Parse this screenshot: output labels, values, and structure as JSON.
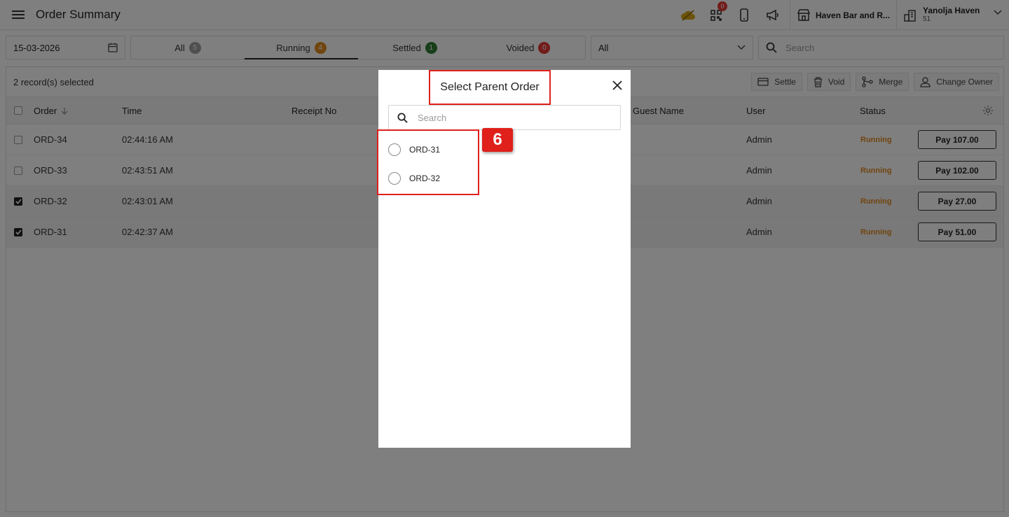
{
  "header": {
    "title": "Order Summary",
    "menu_icon": "hamburger-icon",
    "notification_count": "0",
    "venue_name": "Haven Bar and R...",
    "account_name": "Yanolja Haven",
    "account_sub": "51"
  },
  "filters": {
    "date": "15-03-2026",
    "tabs": [
      {
        "label": "All",
        "count": "5",
        "color": "#9e9e9e"
      },
      {
        "label": "Running",
        "count": "4",
        "color": "#e08a1e"
      },
      {
        "label": "Settled",
        "count": "1",
        "color": "#2e7d32"
      },
      {
        "label": "Voided",
        "count": "0",
        "color": "#e53935"
      }
    ],
    "active_tab": "Running",
    "status_value": "All",
    "search_placeholder": "Search"
  },
  "toolbar": {
    "selected_text": "2 record(s) selected",
    "actions": [
      "Settle",
      "Void",
      "Merge",
      "Change Owner"
    ]
  },
  "table": {
    "columns": [
      "Order",
      "Time",
      "Receipt No",
      "Guest Name",
      "User",
      "Status"
    ],
    "rows": [
      {
        "order": "ORD-34",
        "time": "02:44:16 AM",
        "user": "Admin",
        "status": "Running",
        "pay": "Pay 107.00",
        "checked": false
      },
      {
        "order": "ORD-33",
        "time": "02:43:51 AM",
        "user": "Admin",
        "status": "Running",
        "pay": "Pay 102.00",
        "checked": false
      },
      {
        "order": "ORD-32",
        "time": "02:43:01 AM",
        "user": "Admin",
        "status": "Running",
        "pay": "Pay 27.00",
        "checked": true
      },
      {
        "order": "ORD-31",
        "time": "02:42:37 AM",
        "user": "Admin",
        "status": "Running",
        "pay": "Pay 51.00",
        "checked": true
      }
    ]
  },
  "modal": {
    "title": "Select Parent Order",
    "search_placeholder": "Search",
    "options": [
      "ORD-31",
      "ORD-32"
    ],
    "step_badge": "6"
  },
  "colors": {
    "accent_red": "#e0201b",
    "running_orange": "#e08a1e"
  }
}
